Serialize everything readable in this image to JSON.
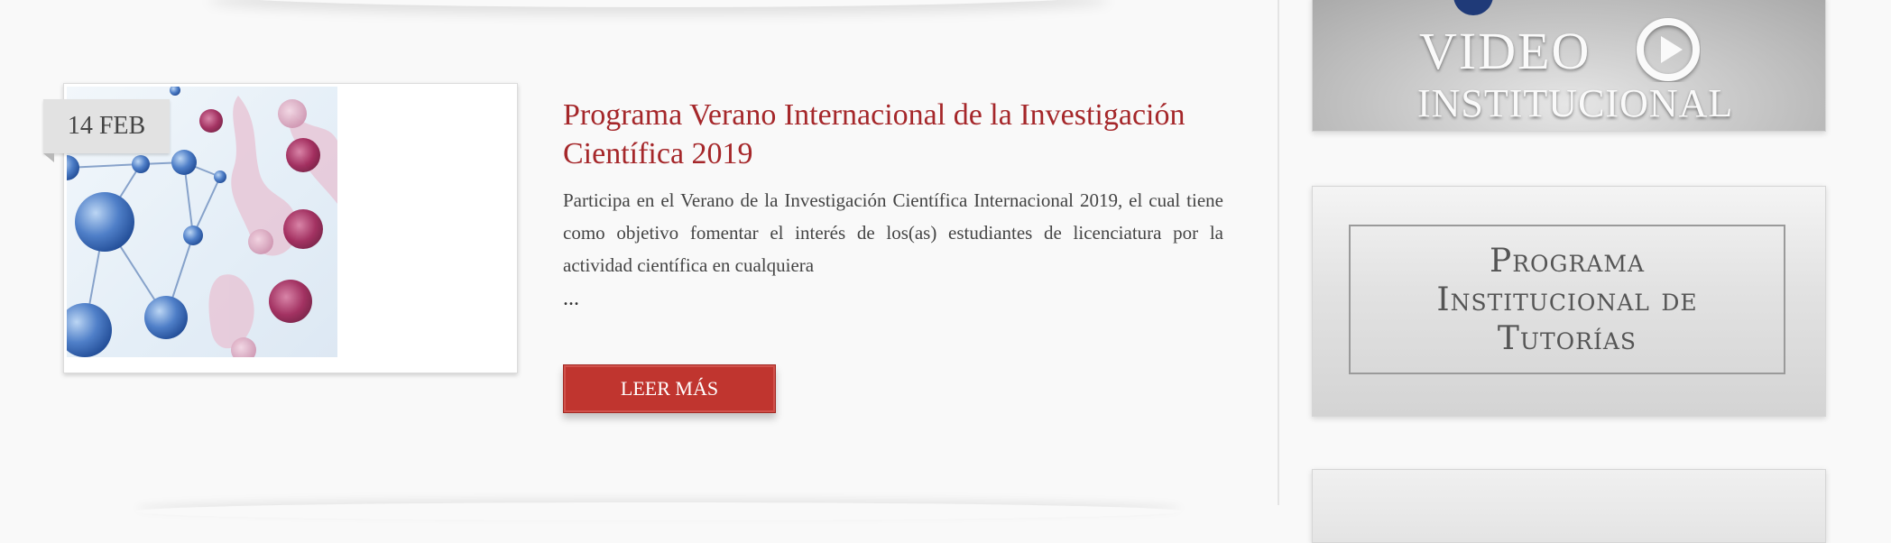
{
  "post": {
    "date": "14 FEB",
    "title": "Programa Verano Internacional de la Investigación Científica 2019",
    "excerpt": "Participa en el Verano de la Investigación Científica Internacional 2019, el cual tiene como objetivo fomentar el interés de los(as) estudiantes de licenciatura por la actividad científica en cualquiera",
    "ellipsis": "...",
    "read_more": "LEER MÁS",
    "image_icon": "molecule-illustration"
  },
  "sidebar": {
    "video_banner": {
      "line1": "VIDEO",
      "line2": "INSTITUCIONAL",
      "icon": "play-icon"
    },
    "tutorias_banner": {
      "line1": "Programa",
      "line2": "Institucional de",
      "line3": "Tutorías"
    }
  },
  "colors": {
    "accent": "#a5272a",
    "button": "#c0352f",
    "background": "#f9f9f9"
  }
}
